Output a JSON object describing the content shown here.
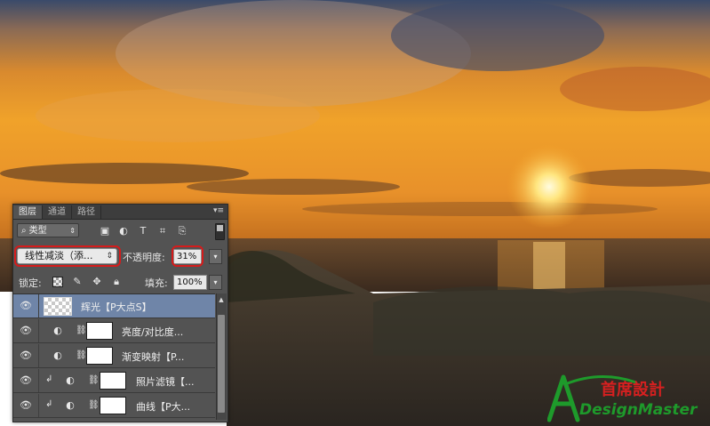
{
  "panel": {
    "tabs": [
      {
        "label": "图层",
        "active": true
      },
      {
        "label": "通道",
        "active": false
      },
      {
        "label": "路径",
        "active": false
      }
    ],
    "filter_kind": "类型",
    "blend_mode": "线性减淡（添...",
    "opacity_label": "不透明度:",
    "opacity_value": "31%",
    "lock_label": "锁定:",
    "fill_label": "填充:",
    "fill_value": "100%"
  },
  "layers": [
    {
      "name": "辉光【P大点S】",
      "selected": true,
      "type": "pixel"
    },
    {
      "name": "亮度/对比度...",
      "selected": false,
      "type": "adjustment"
    },
    {
      "name": "渐变映射【P...",
      "selected": false,
      "type": "adjustment"
    },
    {
      "name": "照片滤镜【...",
      "selected": false,
      "type": "adjustment-clipped"
    },
    {
      "name": "曲线【P大...",
      "selected": false,
      "type": "adjustment-clipped"
    }
  ],
  "logo": {
    "brand": "首席設計",
    "sub": "DesignMaster"
  },
  "colors": {
    "highlight": "#d61b1b",
    "selected_layer": "#6f85a8",
    "panel_bg": "#535353",
    "logo_green": "#1e9a2b",
    "logo_red": "#d62020"
  }
}
